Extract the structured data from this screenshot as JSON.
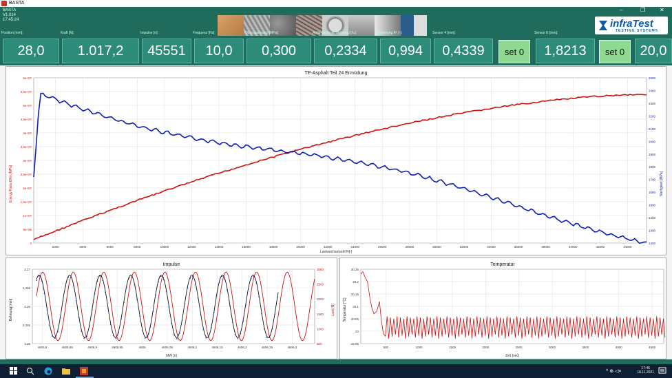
{
  "window": {
    "title": "BASTA",
    "controls": [
      "–",
      "❐",
      "✕"
    ]
  },
  "header": {
    "app": "BASTA",
    "version": "V1.014",
    "time": "17:45:24"
  },
  "logo": {
    "brand": "infraTest",
    "tagline": "TESTING SYSTEMS",
    "icon": "hourglass-logo-icon"
  },
  "values": [
    {
      "label": "Position [mm]:",
      "value": "28,0"
    },
    {
      "label": "Kraft [N]:",
      "value": "1.017,2"
    },
    {
      "label": "Impulse [n]:",
      "value": "45551"
    },
    {
      "label": "Frequenz [Hz]:",
      "value": "10,0"
    },
    {
      "label": "Oberspannung [MPa]:",
      "value": "0,300"
    },
    {
      "label": "Anfängliche el. dehnung [‰]:",
      "value": "0,2334"
    },
    {
      "label": "Dehnung R² [-]:",
      "value": "0,994"
    },
    {
      "label": "Sensor 4 [mm]:",
      "value": "0,4339"
    },
    {
      "label": "Sensor E [mm]:",
      "value": "1,8213"
    },
    {
      "label": "Temperatur [°C]:",
      "value": "20,0"
    }
  ],
  "set_buttons": [
    "set 0",
    "set 0"
  ],
  "main_chart": {
    "title": "TP-Asphalt Teil 24 Ermüdung",
    "xlabel": "Lastwechselzahl N[-]",
    "ylabel_left": "Energy Ratio ERn [MPa]",
    "ylabel_right": "Steifigkeit [MPa]",
    "x_ticks": [
      "2000",
      "4000",
      "6000",
      "8000",
      "10000",
      "12000",
      "14000",
      "16000",
      "18000",
      "20000",
      "22000",
      "24000",
      "26000",
      "28000",
      "30000",
      "32000",
      "34000",
      "36000",
      "38000",
      "40000",
      "42000",
      "44000"
    ],
    "y_left_ticks": [
      "0",
      "5e+06",
      "1e+07",
      "1,5e+07",
      "2e+07",
      "2,5e+07",
      "3e+07",
      "3,5e+07",
      "4e+07",
      "4,5e+07",
      "5e+07",
      "5,5e+07",
      "6e+07"
    ],
    "y_right_ticks": [
      "1200",
      "1300",
      "1400",
      "1500",
      "1600",
      "1700",
      "1800",
      "1900",
      "2000",
      "2100",
      "2200",
      "2300",
      "2400",
      "2500"
    ]
  },
  "impulse_chart": {
    "title": "Impulse",
    "xlabel": "MW [n]",
    "ylabel_left": "Dehnung [mm]",
    "ylabel_right": "Last [N]",
    "x_ticks": [
      "4605,8",
      "4605,85",
      "4605,9",
      "4605,95",
      "4606",
      "4606,05",
      "4606,1",
      "4606,15",
      "4606,2",
      "4606,25",
      "4606,3"
    ],
    "y_left_ticks": [
      "2,25",
      "2,255",
      "2,26",
      "2,265",
      "2,27"
    ],
    "y_right_ticks": [
      "500",
      "1000",
      "1500",
      "2000",
      "2500",
      "3000"
    ]
  },
  "temp_chart": {
    "title": "Temperatur",
    "xlabel": "Zeit [sec]",
    "ylabel": "Temperatur [°C]",
    "x_ticks": [
      "500",
      "1000",
      "1500",
      "2000",
      "2500",
      "3000",
      "3500",
      "4000",
      "4500"
    ],
    "y_ticks": [
      "19,95",
      "20",
      "20,05",
      "20,1",
      "20,15",
      "20,2",
      "20,25"
    ]
  },
  "taskbar": {
    "time": "17:45",
    "date": "18.11.2021"
  },
  "colors": {
    "header": "#1f6b5c",
    "value_box": "#2d8b7a",
    "set_button": "#8fd990",
    "red_series": "#cc1111",
    "blue_series": "#0a1fb5"
  }
}
